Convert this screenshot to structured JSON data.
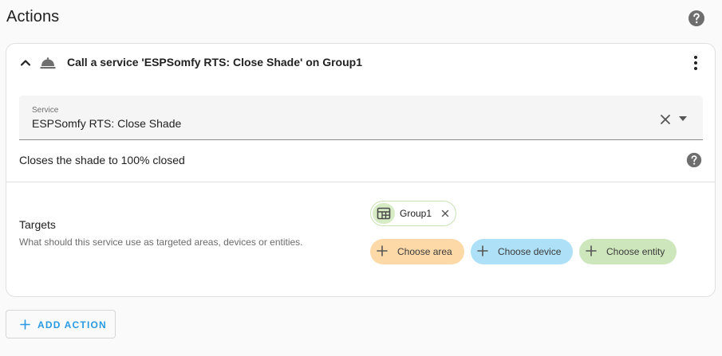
{
  "page": {
    "title": "Actions"
  },
  "action": {
    "title": "Call a service 'ESPSomfy RTS: Close Shade' on Group1",
    "service": {
      "label": "Service",
      "value": "ESPSomfy RTS: Close Shade",
      "description": "Closes the shade to 100% closed"
    },
    "targets": {
      "label": "Targets",
      "description": "What should this service use as targeted areas, devices or entities.",
      "selected": [
        {
          "label": "Group1",
          "icon": "group-icon"
        }
      ],
      "choose_area": "Choose area",
      "choose_device": "Choose device",
      "choose_entity": "Choose entity"
    }
  },
  "add_action": {
    "label": "ADD ACTION"
  },
  "icons": {
    "help": "help-circle-icon",
    "collapse": "chevron-up-icon",
    "service": "room-service-icon",
    "menu": "dots-vertical-icon",
    "clear": "close-icon",
    "dropdown": "menu-down-icon",
    "plus": "plus-icon"
  },
  "colors": {
    "accent": "#2a9ae0",
    "area_chip": "#fdd9a8",
    "device_chip": "#aee0f7",
    "entity_chip": "#cde6bc",
    "group_chip": "#d7ecc5"
  }
}
